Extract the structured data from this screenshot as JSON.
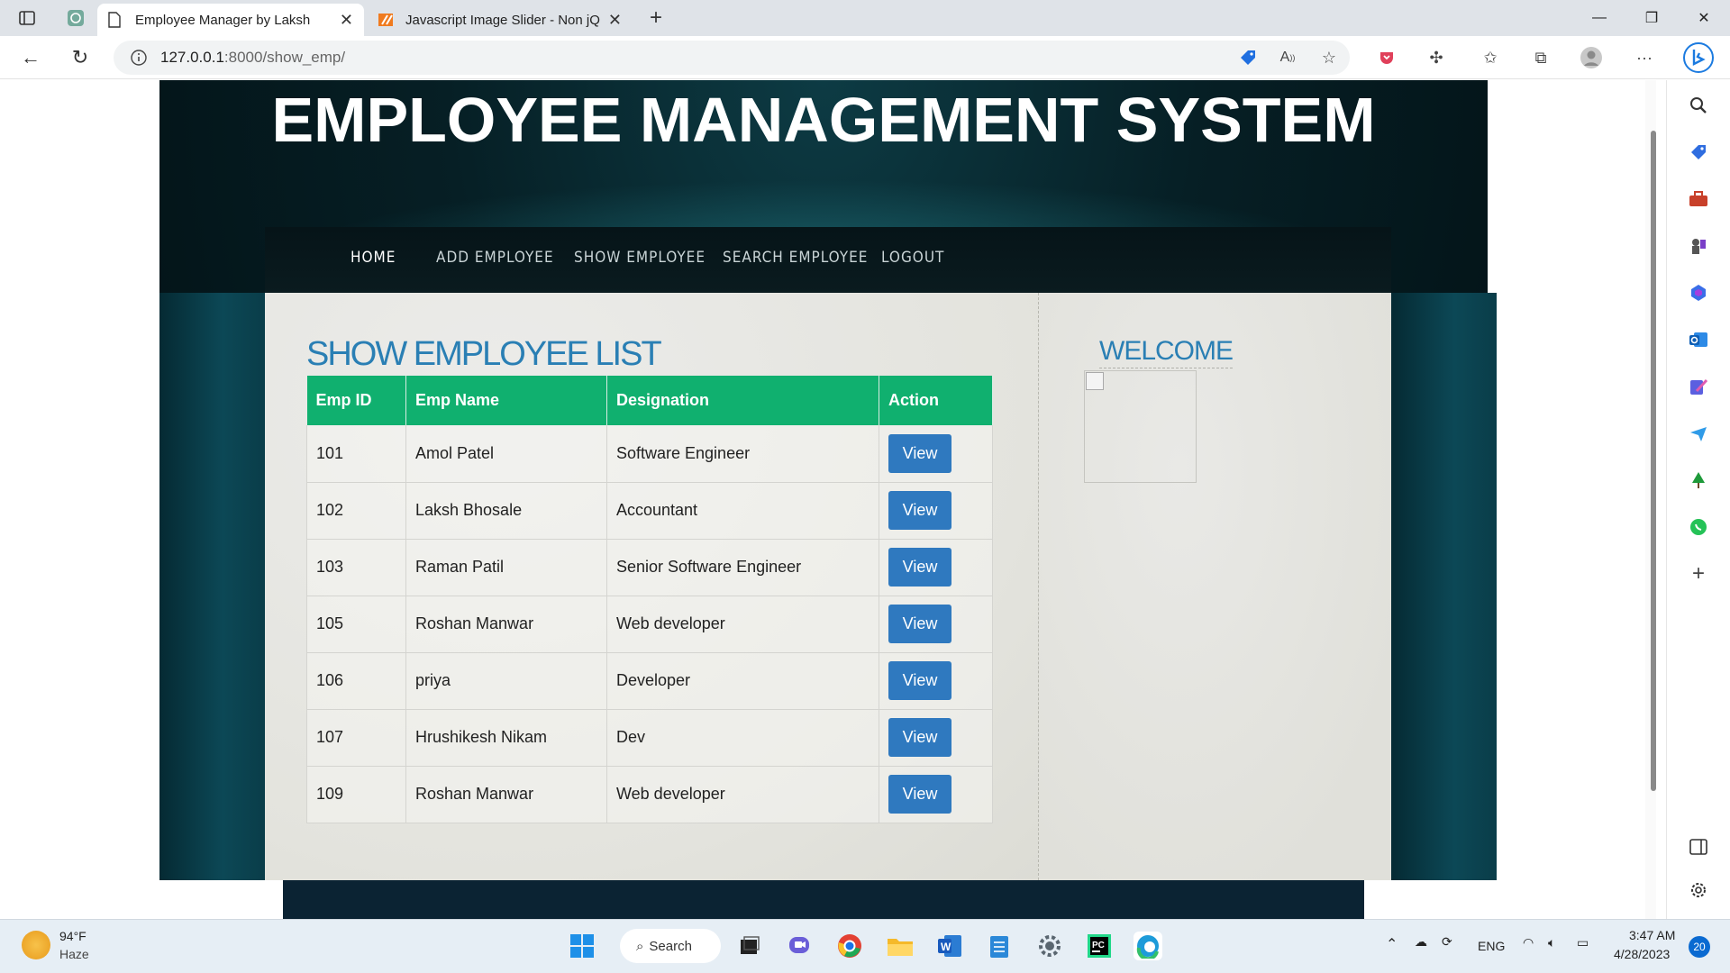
{
  "browser": {
    "tabs": [
      {
        "title": "Employee Manager by Laksh",
        "active": true
      },
      {
        "title": "Javascript Image Slider - Non jQ",
        "active": false
      }
    ],
    "url_host": "127.0.0.1",
    "url_path": ":8000/show_emp/"
  },
  "site": {
    "title": "EMPLOYEE MANAGEMENT SYSTEM",
    "menu": [
      "HOME",
      "ADD EMPLOYEE",
      "SHOW EMPLOYEE",
      "SEARCH EMPLOYEE",
      "LOGOUT"
    ],
    "section_heading": "SHOW EMPLOYEE LIST",
    "table": {
      "headers": [
        "Emp ID",
        "Emp Name",
        "Designation",
        "Action"
      ],
      "rows": [
        {
          "id": "101",
          "name": "Amol Patel",
          "designation": "Software Engineer",
          "action": "View"
        },
        {
          "id": "102",
          "name": "Laksh Bhosale",
          "designation": "Accountant",
          "action": "View"
        },
        {
          "id": "103",
          "name": "Raman Patil",
          "designation": "Senior Software Engineer",
          "action": "View"
        },
        {
          "id": "105",
          "name": "Roshan Manwar",
          "designation": "Web developer",
          "action": "View"
        },
        {
          "id": "106",
          "name": "priya",
          "designation": "Developer",
          "action": "View"
        },
        {
          "id": "107",
          "name": "Hrushikesh Nikam",
          "designation": "Dev",
          "action": "View"
        },
        {
          "id": "109",
          "name": "Roshan Manwar",
          "designation": "Web developer",
          "action": "View"
        }
      ]
    },
    "welcome": "WELCOME"
  },
  "taskbar": {
    "weather_temp": "94°F",
    "weather_desc": "Haze",
    "search_label": "Search",
    "lang": "ENG",
    "time": "3:47 AM",
    "date": "4/28/2023",
    "notifications": "20"
  },
  "colors": {
    "table_header": "#10b06f",
    "view_button": "#2f79bf",
    "heading_blue": "#2a7fb4"
  }
}
